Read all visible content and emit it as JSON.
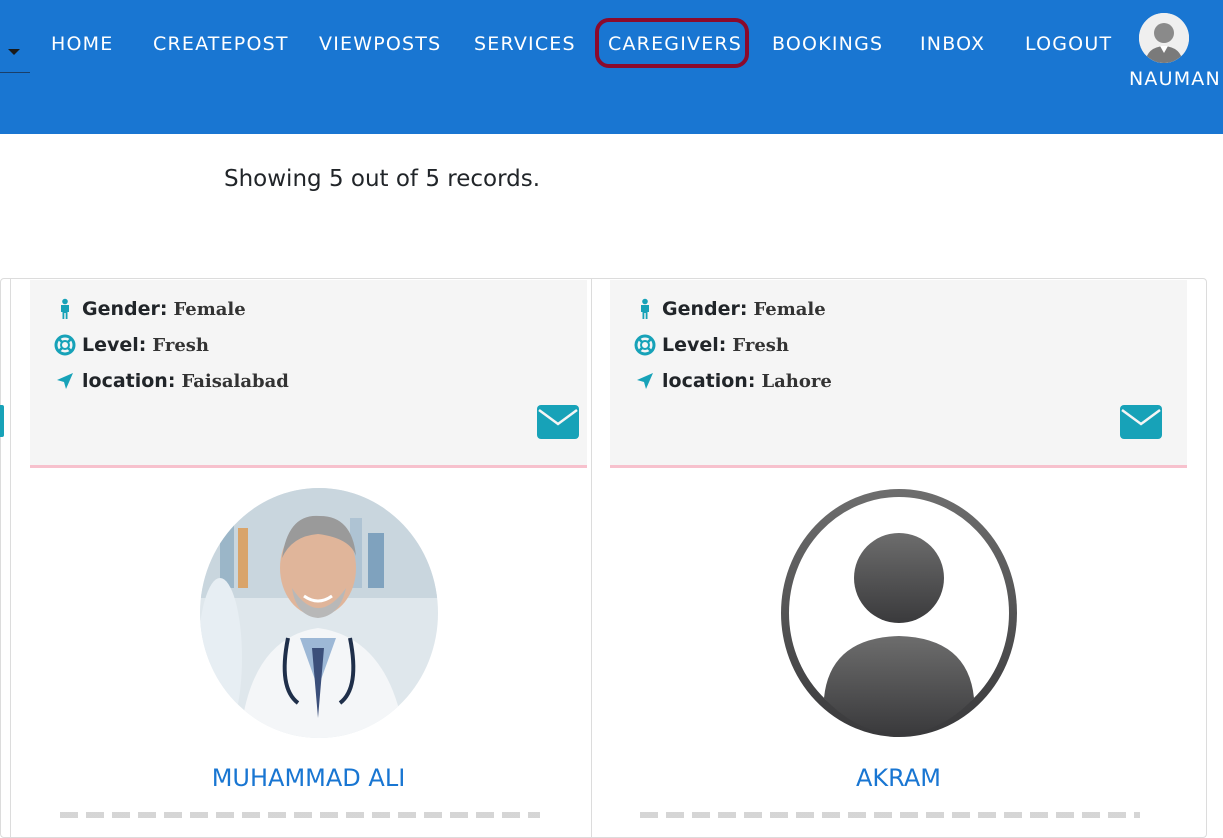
{
  "nav": {
    "items": [
      "HOME",
      "CREATEPOST",
      "VIEWPOSTS",
      "SERVICES",
      "CAREGIVERS",
      "BOOKINGS",
      "INBOX",
      "LOGOUT"
    ],
    "active": "CAREGIVERS",
    "user_name": "NAUMAN"
  },
  "records_text": "Showing 5 out of 5 records.",
  "cards": [
    {
      "gender_label": "Gender:",
      "gender": "Female",
      "level_label": "Level:",
      "level": "Fresh",
      "location_label": "location:",
      "location": "Faisalabad",
      "name": "MUHAMMAD ALI",
      "photo": "doctor-photo"
    },
    {
      "gender_label": "Gender:",
      "gender": "Female",
      "level_label": "Level:",
      "level": "Fresh",
      "location_label": "location:",
      "location": "Lahore",
      "name": "AKRAM",
      "photo": "default-avatar"
    }
  ],
  "colors": {
    "navbar": "#1976d2",
    "highlight": "#8b0a2c",
    "icon_teal": "#17a2b8",
    "name_link": "#1976d2",
    "divider_pink": "#f7c1cd"
  }
}
